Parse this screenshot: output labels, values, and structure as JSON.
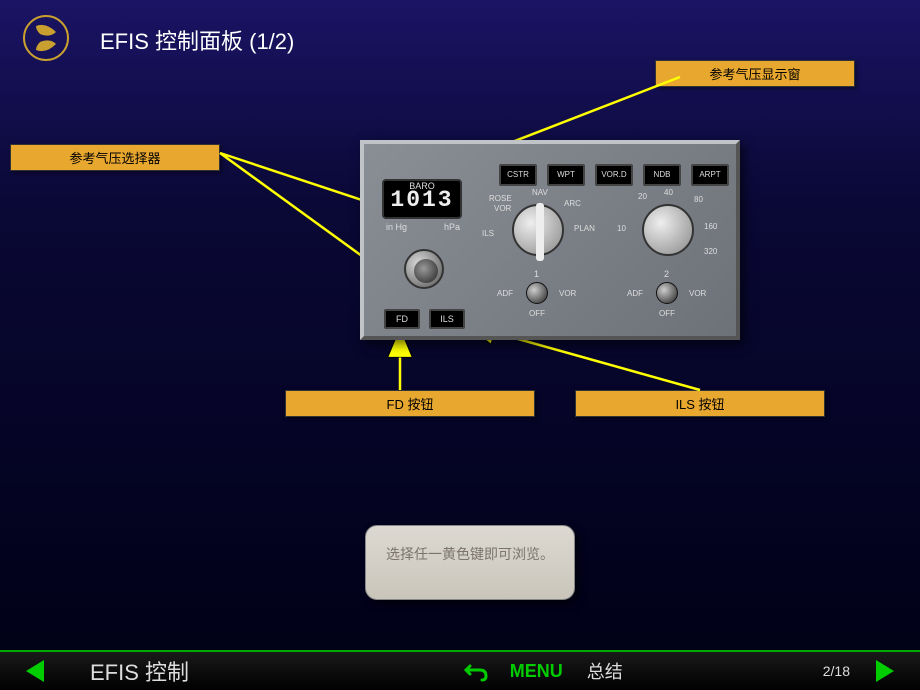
{
  "title": "EFIS 控制面板 (1/2)",
  "callouts": {
    "baro_selector": "参考气压选择器",
    "baro_window": "参考气压显示窗",
    "fd_button": "FD 按钮",
    "ils_button": "ILS 按钮"
  },
  "panel": {
    "baro_label": "BARO",
    "baro_value": "1013",
    "unit_inhg": "in Hg",
    "unit_hpa": "hPa",
    "mode": {
      "rose": "ROSE",
      "vor": "VOR",
      "nav": "NAV",
      "ils": "ILS",
      "arc": "ARC",
      "plan": "PLAN"
    },
    "range": {
      "r10": "10",
      "r20": "20",
      "r40": "40",
      "r80": "80",
      "r160": "160",
      "r320": "320"
    },
    "top_buttons": [
      "CSTR",
      "WPT",
      "VOR.D",
      "NDB",
      "ARPT"
    ],
    "fd_label": "FD",
    "ils_label": "ILS",
    "adf": "ADF",
    "vor_lbl": "VOR",
    "off": "OFF",
    "num1": "1",
    "num2": "2"
  },
  "tooltip": "选择任一黄色键即可浏览。",
  "footer": {
    "section": "EFIS 控制",
    "menu": "MENU",
    "summary": "总结",
    "page": "2/18"
  }
}
